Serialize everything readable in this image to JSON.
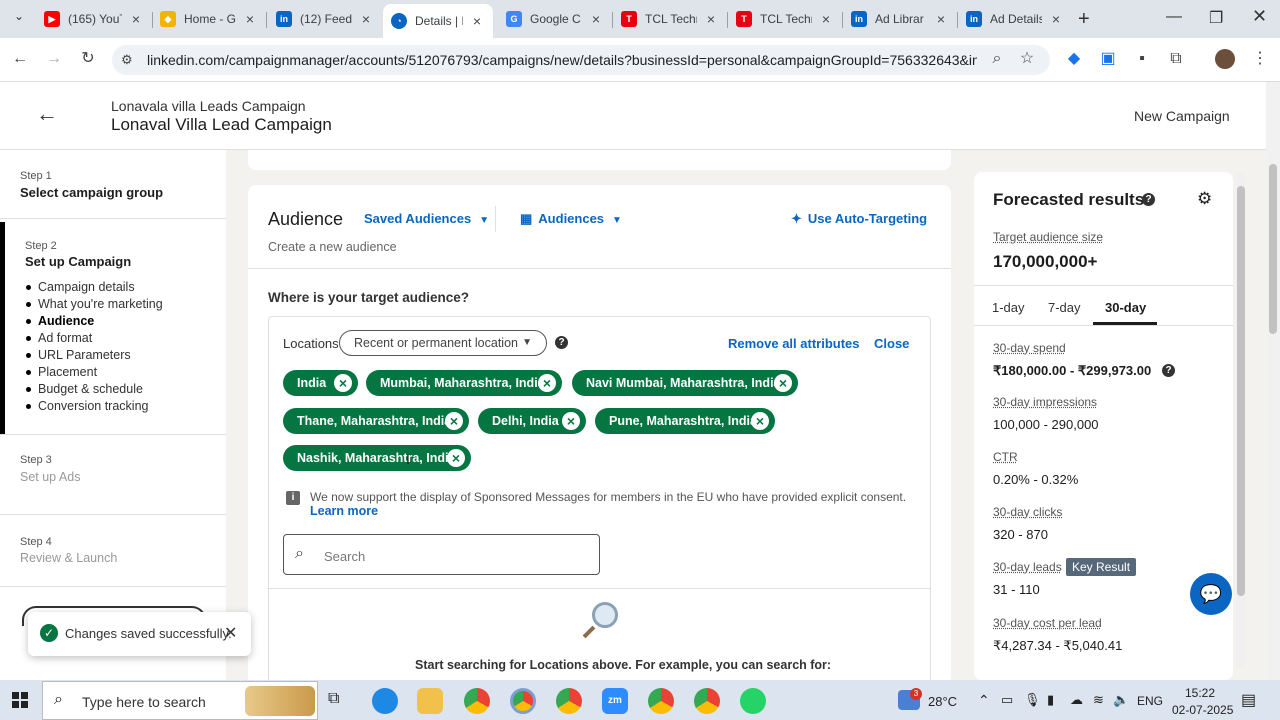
{
  "browser": {
    "tabs": [
      {
        "label": "(165) YouT",
        "favicon": "youtube-icon",
        "color": "#ff0000"
      },
      {
        "label": "Home - G",
        "favicon": "google-ads-icon",
        "color": "#e8a400"
      },
      {
        "label": "(12) Feed",
        "favicon": "linkedin-icon",
        "color": "#0a66c2"
      },
      {
        "label": "Details | L",
        "favicon": "linkedin-campaign-icon",
        "color": "#0a66c2"
      },
      {
        "label": "Google C",
        "favicon": "google-icon",
        "color": "#4285f4"
      },
      {
        "label": "TCL Techn",
        "favicon": "tcl-icon",
        "color": "#e60012"
      },
      {
        "label": "TCL Techn",
        "favicon": "tcl-icon",
        "color": "#e60012"
      },
      {
        "label": "Ad Librar",
        "favicon": "linkedin-icon",
        "color": "#0a66c2"
      },
      {
        "label": "Ad Details",
        "favicon": "linkedin-icon",
        "color": "#0a66c2"
      }
    ],
    "url": "linkedin.com/campaignmanager/accounts/512076793/campaigns/new/details?businessId=personal&campaignGroupId=756332643&initialO..."
  },
  "header": {
    "campaign_group": "Lonavala villa Leads Campaign",
    "campaign_name": "Lonaval Villa Lead Campaign",
    "right_label": "New Campaign"
  },
  "steps": {
    "step1": {
      "label": "Step 1",
      "title": "Select campaign group"
    },
    "step2": {
      "label": "Step 2",
      "title": "Set up Campaign",
      "items": [
        "Campaign details",
        "What you're marketing",
        "Audience",
        "Ad format",
        "URL Parameters",
        "Placement",
        "Budget & schedule",
        "Conversion tracking"
      ]
    },
    "step3": {
      "label": "Step 3",
      "title": "Set up Ads"
    },
    "step4": {
      "label": "Step 4",
      "title": "Review & Launch"
    }
  },
  "toast": {
    "message": "Changes saved successfully."
  },
  "audience": {
    "title": "Audience",
    "saved_audiences": "Saved Audiences",
    "audiences": "Audiences",
    "auto_targeting": "Use Auto-Targeting",
    "create_new": "Create a new audience",
    "question": "Where is your target audience?",
    "locations_label": "Locations",
    "location_type": "Recent or permanent location",
    "remove_all": "Remove all attributes",
    "close": "Close",
    "locations": [
      "India",
      "Mumbai, Maharashtra, India",
      "Navi Mumbai, Maharashtra, India",
      "Thane, Maharashtra, India",
      "Delhi, India",
      "Pune, Maharashtra, India",
      "Nashik, Maharashtra, India"
    ],
    "eu_notice": "We now support the display of Sponsored Messages for members in the EU who have provided explicit consent.",
    "learn_more": "Learn more",
    "search_placeholder": "Search",
    "search_hint": "Start searching for Locations above. For example, you can search for:"
  },
  "forecast": {
    "title": "Forecasted results",
    "audience_size_label": "Target audience size",
    "audience_size": "170,000,000+",
    "tabs": [
      "1-day",
      "7-day",
      "30-day"
    ],
    "active_tab": "30-day",
    "metrics": [
      {
        "label": "30-day spend",
        "value": "₹180,000.00 - ₹299,973.00"
      },
      {
        "label": "30-day impressions",
        "value": "100,000 - 290,000"
      },
      {
        "label": "CTR",
        "value": "0.20% - 0.32%"
      },
      {
        "label": "30-day clicks",
        "value": "320 - 870"
      },
      {
        "label": "30-day leads",
        "value": "31 - 110",
        "badge": "Key Result"
      },
      {
        "label": "30-day cost per lead",
        "value": "₹4,287.34 - ₹5,040.41"
      }
    ]
  },
  "taskbar": {
    "search_placeholder": "Type here to search",
    "temperature": "28°C",
    "language": "ENG",
    "time": "15:22",
    "date": "02-07-2025",
    "notification_count": "3"
  }
}
